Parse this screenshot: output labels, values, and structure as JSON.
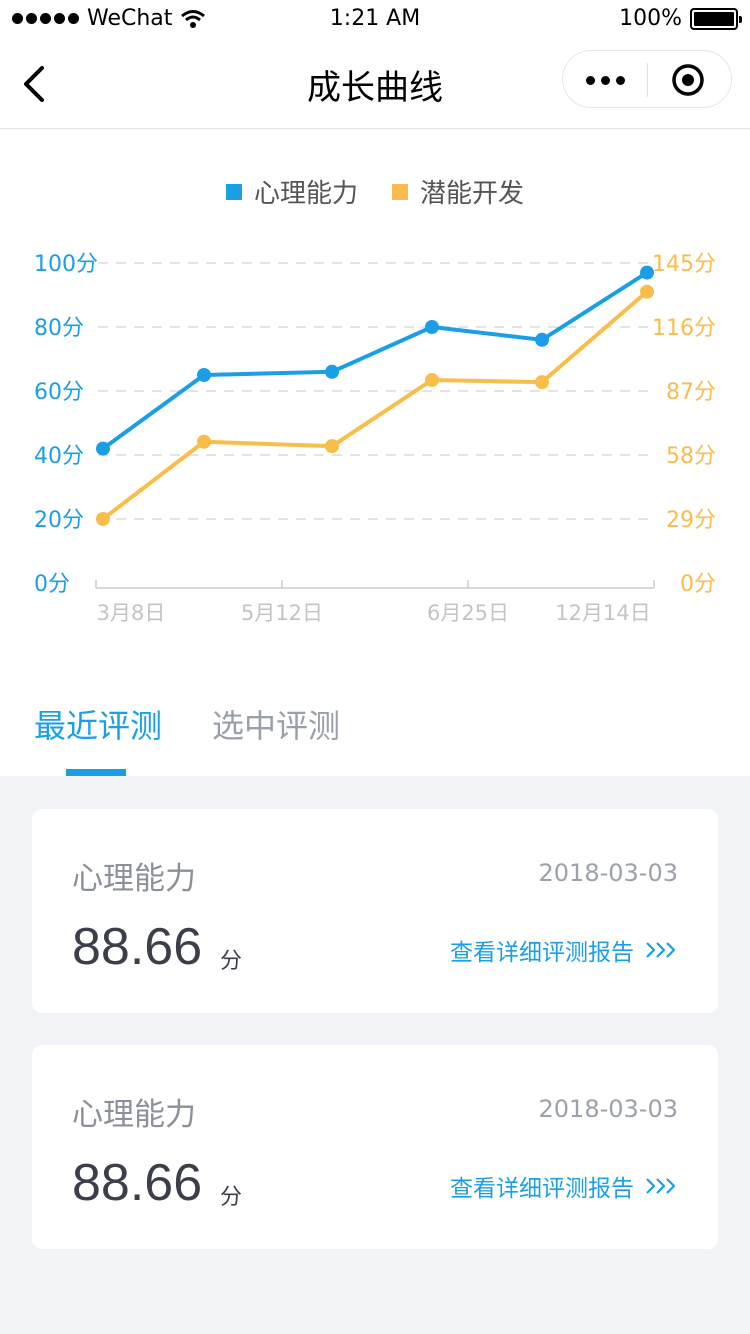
{
  "status_bar": {
    "carrier": "WeChat",
    "time": "1:21 AM",
    "battery": "100%"
  },
  "nav": {
    "title": "成长曲线"
  },
  "chart_data": {
    "type": "line",
    "legend": [
      {
        "name": "心理能力",
        "color": "#1a9fe6"
      },
      {
        "name": "潜能开发",
        "color": "#f9bd4a"
      }
    ],
    "left_axis": {
      "ticks": [
        "0分",
        "20分",
        "40分",
        "60分",
        "80分",
        "100分"
      ],
      "range": [
        0,
        100
      ],
      "color": "#1a9fe6"
    },
    "right_axis": {
      "ticks": [
        "0分",
        "29分",
        "58分",
        "87分",
        "116分",
        "145分"
      ],
      "range": [
        0,
        145
      ],
      "color": "#f9bd4a"
    },
    "x_tick_labels": [
      "3月8日",
      "5月12日",
      "6月25日",
      "12月14日"
    ],
    "series": [
      {
        "name": "心理能力",
        "axis": "left",
        "values": [
          42,
          65,
          66,
          80,
          76,
          97
        ]
      },
      {
        "name": "潜能开发",
        "axis": "right",
        "values": [
          29,
          64,
          62,
          92,
          91,
          132
        ]
      }
    ],
    "grid": "dashed"
  },
  "tabs": [
    {
      "label": "最近评测",
      "active": true
    },
    {
      "label": "选中评测",
      "active": false
    }
  ],
  "cards": [
    {
      "title": "心理能力",
      "date": "2018-03-03",
      "score": "88.66",
      "unit": "分",
      "link": "查看详细评测报告"
    },
    {
      "title": "心理能力",
      "date": "2018-03-03",
      "score": "88.66",
      "unit": "分",
      "link": "查看详细评测报告"
    }
  ]
}
